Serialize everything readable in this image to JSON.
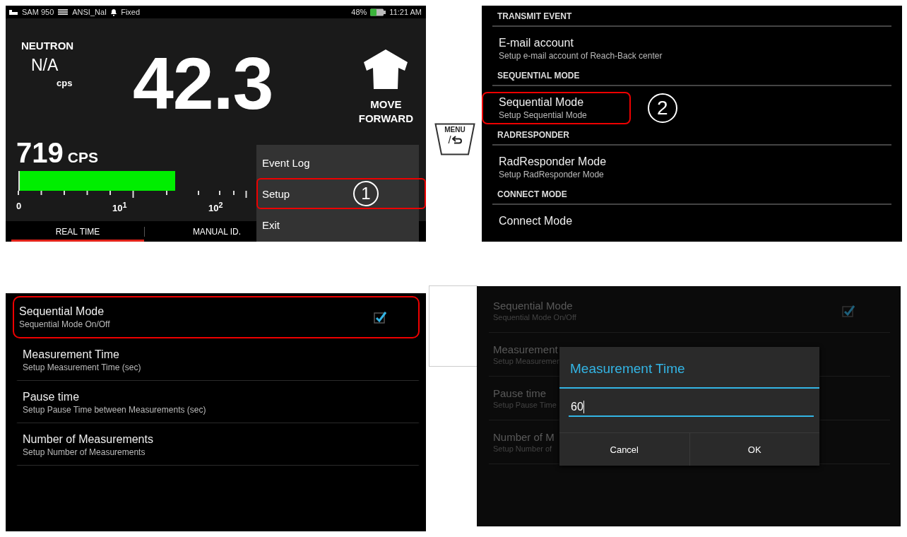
{
  "main_screen": {
    "status_bar": {
      "device": "SAM 950",
      "library": "ANSI_NaI",
      "mode": "Fixed",
      "battery_percent": "48%",
      "time": "11:21 AM"
    },
    "neutron": {
      "label": "NEUTRON",
      "value": "N/A",
      "unit": "cps"
    },
    "reading": "42.3",
    "direction": {
      "lines": [
        "MOVE",
        "FORWARD"
      ]
    },
    "count": {
      "value": "719",
      "unit": "CPS"
    },
    "meter": {
      "level": 0.39,
      "scale_labels": [
        "0",
        "10$^{1}$",
        "10$^{2}$"
      ]
    },
    "tabs": [
      {
        "label": "REAL TIME",
        "selected": true
      },
      {
        "label": "MANUAL ID.",
        "selected": false
      }
    ],
    "menu": [
      {
        "label": "Event Log",
        "highlighted": false
      },
      {
        "label": "Setup",
        "highlighted": true,
        "step": "1"
      },
      {
        "label": "Exit",
        "highlighted": false
      }
    ]
  },
  "menu_key": {
    "top": "MENU",
    "bottom": "/"
  },
  "settings_screen": {
    "sections": [
      {
        "header": "TRANSMIT EVENT",
        "items": [
          {
            "title": "E-mail account",
            "subtitle": "Setup e-mail account of Reach-Back center",
            "highlighted": false
          }
        ]
      },
      {
        "header": "SEQUENTIAL MODE",
        "items": [
          {
            "title": "Sequential Mode",
            "subtitle": "Setup Sequential Mode",
            "highlighted": true,
            "step": "2"
          }
        ]
      },
      {
        "header": "RADRESPONDER",
        "items": [
          {
            "title": "RadResponder Mode",
            "subtitle": "Setup RadResponder Mode",
            "highlighted": false
          }
        ]
      },
      {
        "header": "CONNECT MODE",
        "items": [
          {
            "title": "Connect Mode",
            "highlighted": false
          }
        ]
      }
    ]
  },
  "sequential_screen": {
    "items": [
      {
        "kind": "checkbox",
        "title": "Sequential Mode",
        "subtitle": "Sequential Mode On/Off",
        "checked": true,
        "highlighted": true
      },
      {
        "kind": "plain",
        "title": "Measurement Time",
        "subtitle": "Setup Measurement Time (sec)",
        "highlighted": false
      },
      {
        "kind": "plain",
        "title": "Pause time",
        "subtitle": "Setup Pause Time between Measurements (sec)",
        "highlighted": false
      },
      {
        "kind": "plain",
        "title": "Number of Measurements",
        "subtitle": "Setup Number of Measurements",
        "highlighted": false
      }
    ]
  },
  "dialog_screen": {
    "items": [
      {
        "kind": "checkbox",
        "title": "Sequential Mode",
        "subtitle": "Sequential Mode On/Off",
        "checked": true
      },
      {
        "kind": "plain",
        "title": "Measurement",
        "subtitle": "Setup Measuremen"
      },
      {
        "kind": "plain",
        "title": "Pause time",
        "subtitle": "Setup Pause Time"
      },
      {
        "kind": "plain",
        "title": "Number of M",
        "subtitle": "Setup Number of"
      }
    ],
    "dialog": {
      "title": "Measurement Time",
      "value": "60",
      "buttons": [
        "Cancel",
        "OK"
      ]
    }
  }
}
